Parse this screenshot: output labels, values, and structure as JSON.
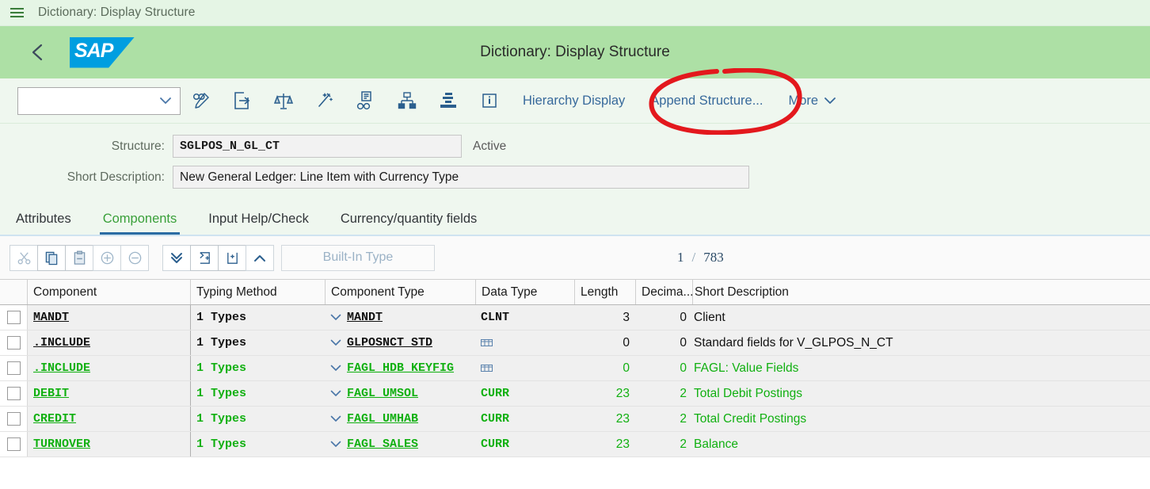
{
  "shell": {
    "menu_icon": "hamburger-menu-icon",
    "title": "Dictionary: Display Structure"
  },
  "header": {
    "back_icon": "back-chevron-icon",
    "logo_text": "SAP",
    "title": "Dictionary: Display Structure"
  },
  "toolbar": {
    "select_value": "",
    "icons": [
      {
        "name": "display-change-icon"
      },
      {
        "name": "transport-export-icon"
      },
      {
        "name": "compare-scales-icon"
      },
      {
        "name": "magic-wand-icon"
      },
      {
        "name": "where-used-binoculars-icon"
      },
      {
        "name": "hierarchy-org-icon"
      },
      {
        "name": "database-indexes-icon"
      },
      {
        "name": "info-icon"
      }
    ],
    "hierarchy_display": "Hierarchy Display",
    "append_structure": "Append Structure...",
    "more": "More",
    "more_icon": "chevron-down-icon",
    "annotation_color": "#e3181d"
  },
  "form": {
    "structure_label": "Structure:",
    "structure_value": "SGLPOS_N_GL_CT",
    "status": "Active",
    "shortdesc_label": "Short Description:",
    "shortdesc_value": "New General Ledger: Line Item with Currency Type"
  },
  "tabs": [
    {
      "label": "Attributes",
      "active": false
    },
    {
      "label": "Components",
      "active": true
    },
    {
      "label": "Input Help/Check",
      "active": false
    },
    {
      "label": "Currency/quantity fields",
      "active": false
    }
  ],
  "table_toolbar": {
    "buttons": [
      {
        "name": "cut-button"
      },
      {
        "name": "copy-button"
      },
      {
        "name": "paste-button"
      },
      {
        "name": "insert-row-button"
      },
      {
        "name": "delete-row-button"
      },
      {
        "name": "scroll-down-button"
      },
      {
        "name": "append-row-button"
      },
      {
        "name": "insert-above-button"
      },
      {
        "name": "scroll-up-button"
      }
    ],
    "builtin_type": "Built-In Type",
    "page_current": "1",
    "page_separator": "/",
    "page_total": "783"
  },
  "grid": {
    "columns": [
      "Component",
      "Typing Method",
      "Component Type",
      "Data Type",
      "Length",
      "Decima...",
      "Short Description"
    ],
    "rows": [
      {
        "component": "MANDT",
        "typing_method": "1 Types",
        "component_type": "MANDT",
        "data_type": "CLNT",
        "data_type_is_icon": false,
        "length": "3",
        "decimals": "0",
        "short_description": "Client",
        "color": "black"
      },
      {
        "component": ".INCLUDE",
        "typing_method": "1 Types",
        "component_type": "GLPOSNCT_STD",
        "data_type": "",
        "data_type_is_icon": true,
        "length": "0",
        "decimals": "0",
        "short_description": "Standard  fields for V_GLPOS_N_CT",
        "color": "black"
      },
      {
        "component": ".INCLUDE",
        "typing_method": "1 Types",
        "component_type": "FAGL_HDB_KEYFIG",
        "data_type": "",
        "data_type_is_icon": true,
        "length": "0",
        "decimals": "0",
        "short_description": "FAGL: Value Fields",
        "color": "green"
      },
      {
        "component": "DEBIT",
        "typing_method": "1 Types",
        "component_type": "FAGL_UMSOL",
        "data_type": "CURR",
        "data_type_is_icon": false,
        "length": "23",
        "decimals": "2",
        "short_description": "Total Debit Postings",
        "color": "green"
      },
      {
        "component": "CREDIT",
        "typing_method": "1 Types",
        "component_type": "FAGL_UMHAB",
        "data_type": "CURR",
        "data_type_is_icon": false,
        "length": "23",
        "decimals": "2",
        "short_description": "Total Credit Postings",
        "color": "green"
      },
      {
        "component": "TURNOVER",
        "typing_method": "1 Types",
        "component_type": "FAGL_SALES",
        "data_type": "CURR",
        "data_type_is_icon": false,
        "length": "23",
        "decimals": "2",
        "short_description": "Balance",
        "color": "green"
      }
    ]
  }
}
